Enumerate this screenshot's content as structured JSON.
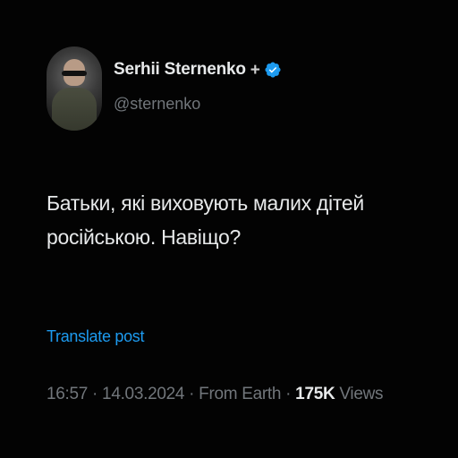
{
  "author": {
    "display_name": "Serhii Sternenko",
    "handle": "@sternenko",
    "badge_symbol": "+",
    "verified_color": "#1d9bf0",
    "avatar_icon": "profile-photo"
  },
  "post": {
    "text_line1": "Батьки, які виховують малих дітей",
    "text_line2": "російською. Навіщо?"
  },
  "translate": {
    "label": "Translate post"
  },
  "meta": {
    "time": "16:57",
    "separator": " · ",
    "date": "14.03.2024",
    "source": "From Earth",
    "views_count": "175K",
    "views_label": "Views"
  },
  "colors": {
    "background": "#030303",
    "text_primary": "#e7e9ea",
    "text_secondary": "#71767b",
    "link": "#1d9bf0"
  }
}
